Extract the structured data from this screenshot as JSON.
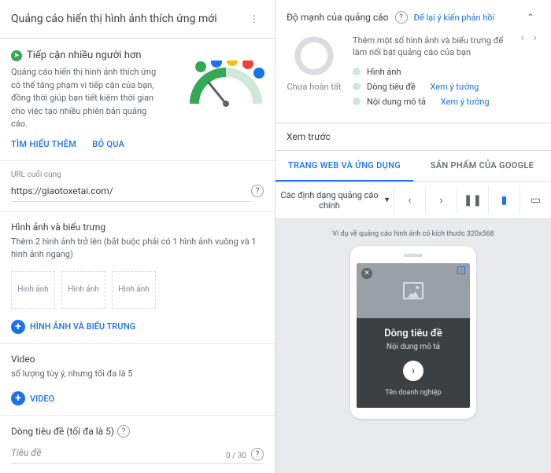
{
  "left": {
    "title": "Quảng cáo hiển thị hình ảnh thích ứng mới",
    "reach": {
      "title": "Tiếp cận nhiều người hơn",
      "desc": "Quảng cáo hiển thị hình ảnh thích ứng có thể tăng phạm vi tiếp cận của bạn, đồng thời giúp bạn tiết kiệm thời gian cho việc tạo nhiều phiên bản quảng cáo.",
      "learn": "TÌM HIỂU THÊM",
      "skip": "BỎ QUA"
    },
    "url": {
      "label": "URL cuối cùng",
      "value": "https://giaotoxetai.com/"
    },
    "images": {
      "title": "Hình ảnh và biểu trưng",
      "sub": "Thêm 2 hình ảnh trở lên (bắt buộc phải có 1 hình ảnh vuông và 1 hình ảnh ngang)",
      "slot": "Hình ảnh",
      "add": "HÌNH ẢNH VÀ BIỂU TRƯNG"
    },
    "video": {
      "title": "Video",
      "sub": "số lượng tùy ý, nhưng tối đa là 5",
      "add": "VIDEO"
    },
    "headline": {
      "title": "Dòng tiêu đề (tối đa là 5)",
      "ph": "Tiêu đề",
      "counter": "0 / 30"
    }
  },
  "right": {
    "strength": {
      "label": "Độ mạnh của quảng cáo",
      "feedback": "Để lại ý kiến phản hồi",
      "status": "Chưa hoàn tất",
      "hint": "Thêm một số hình ảnh và biểu trưng để làm nổi bật quảng cáo của bạn",
      "checks": {
        "img": "Hình ảnh",
        "headline": "Dòng tiêu đề",
        "desc": "Nội dung mô tả",
        "idea": "Xem ý tưởng"
      }
    },
    "preview": {
      "title": "Xem trước",
      "tab1": "TRANG WEB VÀ ỨNG DỤNG",
      "tab2": "SẢN PHẨM CỦA GOOGLE",
      "fmt": "Các định dạng quảng cáo chính",
      "caption": "Ví dụ về quảng cáo hình ảnh có kích thước 320x568",
      "ad": {
        "h": "Dòng tiêu đề",
        "d": "Nội dung mô tả",
        "biz": "Tên doanh nghiệp"
      }
    }
  }
}
